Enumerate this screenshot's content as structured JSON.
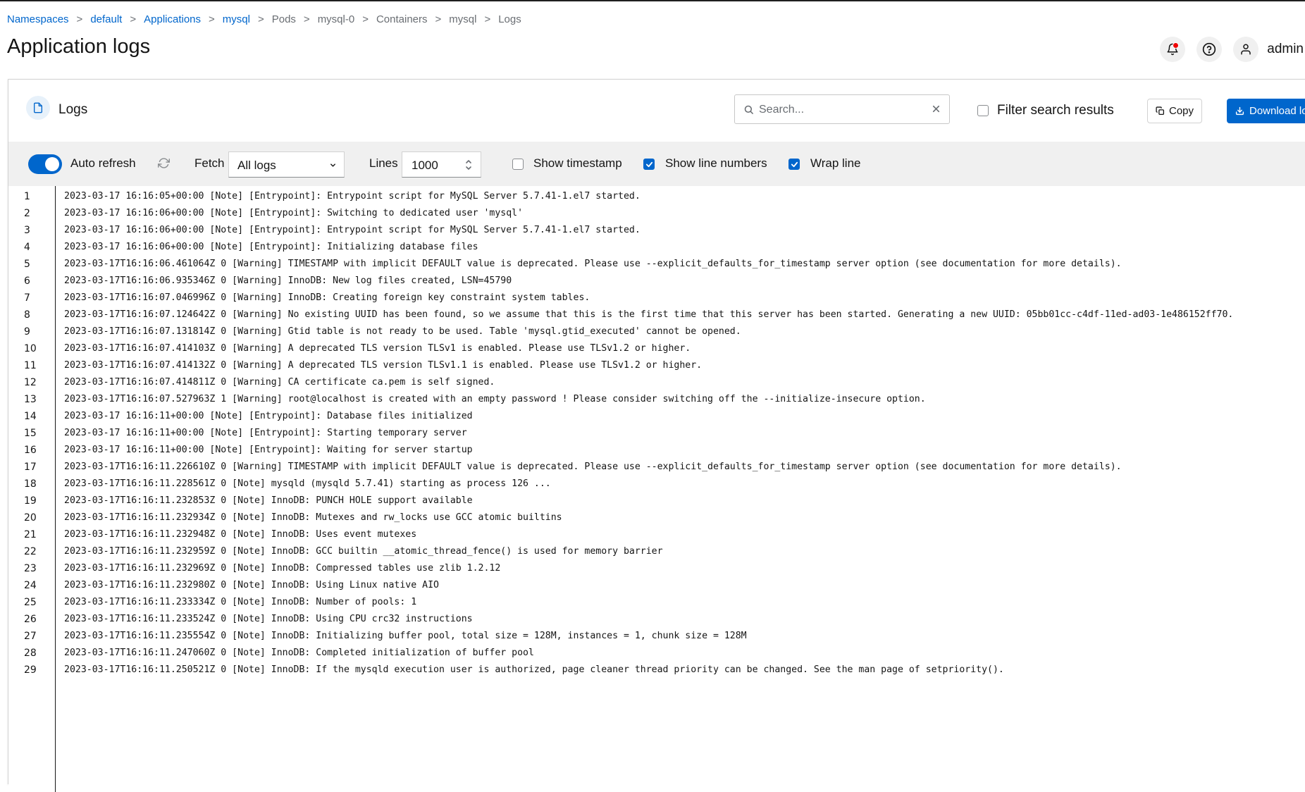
{
  "breadcrumb": [
    {
      "label": "Namespaces",
      "link": true
    },
    {
      "label": "default",
      "link": true
    },
    {
      "label": "Applications",
      "link": true
    },
    {
      "label": "mysql",
      "link": true
    },
    {
      "label": "Pods",
      "link": false
    },
    {
      "label": "mysql-0",
      "link": false
    },
    {
      "label": "Containers",
      "link": false
    },
    {
      "label": "mysql",
      "link": false
    },
    {
      "label": "Logs",
      "link": false
    }
  ],
  "breadcrumb_separator": ">",
  "page": {
    "title": "Application logs"
  },
  "header": {
    "user": "admin",
    "icons": [
      "bell-icon",
      "help-icon",
      "user-icon"
    ]
  },
  "card": {
    "title": "Logs",
    "search_placeholder": "Search...",
    "search_value": "",
    "filter_label": "Filter search results",
    "filter_checked": false,
    "copy_label": "Copy",
    "download_label": "Download logs"
  },
  "toolbar": {
    "auto_refresh_label": "Auto refresh",
    "auto_refresh_on": true,
    "fetch_label": "Fetch",
    "fetch_value": "All logs",
    "lines_label": "Lines",
    "lines_value": "1000",
    "show_timestamp_label": "Show timestamp",
    "show_timestamp_checked": false,
    "show_line_numbers_label": "Show line numbers",
    "show_line_numbers_checked": true,
    "wrap_line_label": "Wrap line",
    "wrap_line_checked": true
  },
  "colors": {
    "accent": "#0066cc",
    "toolbar_bg": "#f0f0f0",
    "notification": "#ee0000"
  },
  "logs": [
    "2023-03-17 16:16:05+00:00 [Note] [Entrypoint]: Entrypoint script for MySQL Server 5.7.41-1.el7 started.",
    "2023-03-17 16:16:06+00:00 [Note] [Entrypoint]: Switching to dedicated user 'mysql'",
    "2023-03-17 16:16:06+00:00 [Note] [Entrypoint]: Entrypoint script for MySQL Server 5.7.41-1.el7 started.",
    "2023-03-17 16:16:06+00:00 [Note] [Entrypoint]: Initializing database files",
    "2023-03-17T16:16:06.461064Z 0 [Warning] TIMESTAMP with implicit DEFAULT value is deprecated. Please use --explicit_defaults_for_timestamp server option (see documentation for more details).",
    "2023-03-17T16:16:06.935346Z 0 [Warning] InnoDB: New log files created, LSN=45790",
    "2023-03-17T16:16:07.046996Z 0 [Warning] InnoDB: Creating foreign key constraint system tables.",
    "2023-03-17T16:16:07.124642Z 0 [Warning] No existing UUID has been found, so we assume that this is the first time that this server has been started. Generating a new UUID: 05bb01cc-c4df-11ed-ad03-1e486152ff70.",
    "2023-03-17T16:16:07.131814Z 0 [Warning] Gtid table is not ready to be used. Table 'mysql.gtid_executed' cannot be opened.",
    "2023-03-17T16:16:07.414103Z 0 [Warning] A deprecated TLS version TLSv1 is enabled. Please use TLSv1.2 or higher.",
    "2023-03-17T16:16:07.414132Z 0 [Warning] A deprecated TLS version TLSv1.1 is enabled. Please use TLSv1.2 or higher.",
    "2023-03-17T16:16:07.414811Z 0 [Warning] CA certificate ca.pem is self signed.",
    "2023-03-17T16:16:07.527963Z 1 [Warning] root@localhost is created with an empty password ! Please consider switching off the --initialize-insecure option.",
    "2023-03-17 16:16:11+00:00 [Note] [Entrypoint]: Database files initialized",
    "2023-03-17 16:16:11+00:00 [Note] [Entrypoint]: Starting temporary server",
    "2023-03-17 16:16:11+00:00 [Note] [Entrypoint]: Waiting for server startup",
    "2023-03-17T16:16:11.226610Z 0 [Warning] TIMESTAMP with implicit DEFAULT value is deprecated. Please use --explicit_defaults_for_timestamp server option (see documentation for more details).",
    "2023-03-17T16:16:11.228561Z 0 [Note] mysqld (mysqld 5.7.41) starting as process 126 ...",
    "2023-03-17T16:16:11.232853Z 0 [Note] InnoDB: PUNCH HOLE support available",
    "2023-03-17T16:16:11.232934Z 0 [Note] InnoDB: Mutexes and rw_locks use GCC atomic builtins",
    "2023-03-17T16:16:11.232948Z 0 [Note] InnoDB: Uses event mutexes",
    "2023-03-17T16:16:11.232959Z 0 [Note] InnoDB: GCC builtin __atomic_thread_fence() is used for memory barrier",
    "2023-03-17T16:16:11.232969Z 0 [Note] InnoDB: Compressed tables use zlib 1.2.12",
    "2023-03-17T16:16:11.232980Z 0 [Note] InnoDB: Using Linux native AIO",
    "2023-03-17T16:16:11.233334Z 0 [Note] InnoDB: Number of pools: 1",
    "2023-03-17T16:16:11.233524Z 0 [Note] InnoDB: Using CPU crc32 instructions",
    "2023-03-17T16:16:11.235554Z 0 [Note] InnoDB: Initializing buffer pool, total size = 128M, instances = 1, chunk size = 128M",
    "2023-03-17T16:16:11.247060Z 0 [Note] InnoDB: Completed initialization of buffer pool",
    "2023-03-17T16:16:11.250521Z 0 [Note] InnoDB: If the mysqld execution user is authorized, page cleaner thread priority can be changed. See the man page of setpriority()."
  ],
  "line_numbers": [
    "1",
    "2",
    "3",
    "4",
    "5",
    "6",
    "7",
    "8",
    "9",
    "10",
    "11",
    "12",
    "13",
    "14",
    "15",
    "16",
    "17",
    "18",
    "19",
    "20",
    "21",
    "22",
    "23",
    "24",
    "25",
    "26",
    "27",
    "28",
    "29"
  ]
}
